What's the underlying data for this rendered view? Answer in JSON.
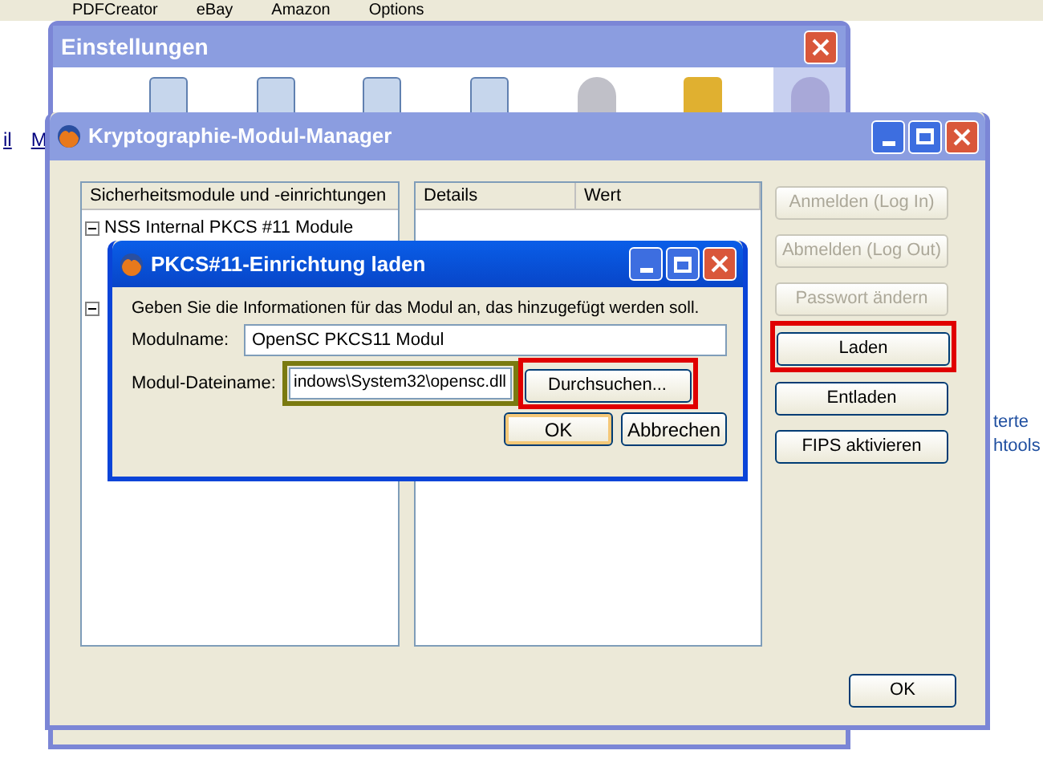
{
  "browser_toolbar": {
    "items": [
      "PDFCreator",
      "eBay",
      "Amazon",
      "Options"
    ]
  },
  "page_behind": {
    "left_links": [
      "il",
      "M"
    ],
    "right_texts": [
      "terte",
      "htools"
    ]
  },
  "settings_window": {
    "title": "Einstellungen",
    "panels": [
      {
        "selected": false
      },
      {
        "selected": false
      },
      {
        "selected": false
      },
      {
        "selected": false
      },
      {
        "selected": false
      },
      {
        "selected": false
      },
      {
        "selected": true
      }
    ]
  },
  "crypto_window": {
    "title": "Kryptographie-Modul-Manager",
    "modules_list": {
      "header": "Sicherheitsmodule und -einrichtungen",
      "items": [
        {
          "label": "NSS Internal PKCS #11 Module",
          "expanded": true
        },
        {
          "expanded": true
        }
      ]
    },
    "details_table": {
      "columns": [
        "Details",
        "Wert"
      ]
    },
    "buttons": [
      {
        "label": "Anmelden (Log In)",
        "disabled": true
      },
      {
        "label": "Abmelden (Log Out)",
        "disabled": true
      },
      {
        "label": "Passwort ändern",
        "disabled": true
      },
      {
        "label": "Laden",
        "disabled": false,
        "color": "#e00000"
      },
      {
        "label": "Entladen",
        "disabled": false
      },
      {
        "label": "FIPS aktivieren",
        "disabled": false
      }
    ],
    "ok_button": "OK"
  },
  "load_dialog": {
    "title": "PKCS#11-Einrichtung laden",
    "instruction": "Geben Sie die Informationen für das Modul an, das hinzugefügt werden soll.",
    "module_name": {
      "label": "Modulname:",
      "value": "OpenSC PKCS11 Modul"
    },
    "module_file": {
      "label": "Modul-Dateiname:",
      "value": "indows\\System32\\opensc.dll",
      "color": "#7a7a10"
    },
    "browse_button": {
      "label": "Durchsuchen...",
      "color": "#e00000"
    },
    "ok_button": "OK",
    "cancel_button": "Abbrechen"
  }
}
